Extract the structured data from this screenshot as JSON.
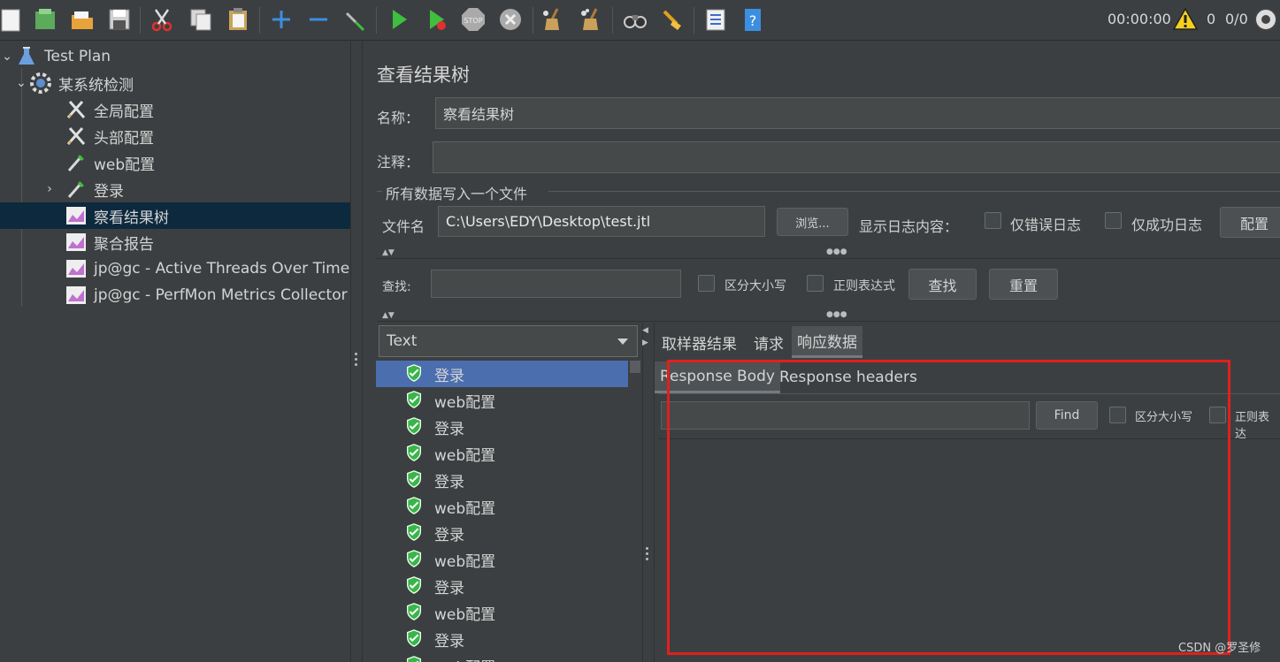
{
  "toolbar": {
    "timer": "00:00:00",
    "warning_count": "0",
    "thread_ratio": "0/0",
    "icons": [
      "new-icon",
      "templates-icon",
      "open-icon",
      "save-icon",
      "cut-icon",
      "copy-icon",
      "paste-icon",
      "expand-icon",
      "collapse-icon",
      "toggle-icon",
      "start-icon",
      "start-no-pauses-icon",
      "stop-icon",
      "shutdown-icon",
      "clear-icon",
      "clear-all-icon",
      "search-icon",
      "reset-search-icon",
      "function-helper-icon",
      "help-icon",
      "warning-icon",
      "remote-icon"
    ]
  },
  "tree": {
    "items": [
      {
        "label": "Test Plan",
        "icon": "flask-icon"
      },
      {
        "label": "某系统检测",
        "icon": "gear-icon"
      },
      {
        "label": "全局配置",
        "icon": "wrench-icon"
      },
      {
        "label": "头部配置",
        "icon": "wrench-icon"
      },
      {
        "label": "web配置",
        "icon": "pipette-icon"
      },
      {
        "label": "登录",
        "icon": "pipette-icon"
      },
      {
        "label": "察看结果树",
        "icon": "graph-icon"
      },
      {
        "label": "聚合报告",
        "icon": "graph-icon"
      },
      {
        "label": "jp@gc - Active Threads Over Time",
        "icon": "graph-icon"
      },
      {
        "label": "jp@gc - PerfMon Metrics Collector",
        "icon": "graph-icon"
      }
    ]
  },
  "main": {
    "title": "查看结果树",
    "name_label": "名称：",
    "name_value": "察看结果树",
    "comment_label": "注释：",
    "comment_value": "",
    "group_title": "所有数据写入一个文件",
    "file_label": "文件名",
    "file_value": "C:\\Users\\EDY\\Desktop\\test.jtl",
    "browse_button": "浏览...",
    "log_content_label": "显示日志内容：",
    "errors_only": "仅错误日志",
    "success_only": "仅成功日志",
    "configure_button": "配置",
    "search_label": "查找:",
    "search_value": "",
    "case_sensitive": "区分大小写",
    "regex": "正则表达式",
    "search_button": "查找",
    "reset_button": "重置"
  },
  "results": {
    "renderer": "Text",
    "items": [
      "登录",
      "web配置",
      "登录",
      "web配置",
      "登录",
      "web配置",
      "登录",
      "web配置",
      "登录",
      "web配置",
      "登录",
      "web配置"
    ],
    "selected_index": 0
  },
  "detail": {
    "tabs": [
      "取样器结果",
      "请求",
      "响应数据"
    ],
    "active_tab": 2,
    "subtabs": [
      "Response Body",
      "Response headers"
    ],
    "active_subtab": 0,
    "find_value": "",
    "find_button": "Find",
    "case_sensitive": "区分大小写",
    "regex": "正则表达"
  },
  "watermark": "CSDN @罗圣修",
  "colors": {
    "background": "#3c3f41",
    "selection_list": "#4b6eaf",
    "selection_tree": "#0d293e",
    "highlight_box": "#e0201c",
    "run_green": "#3fbf3f",
    "shield_green": "#39b54a"
  }
}
